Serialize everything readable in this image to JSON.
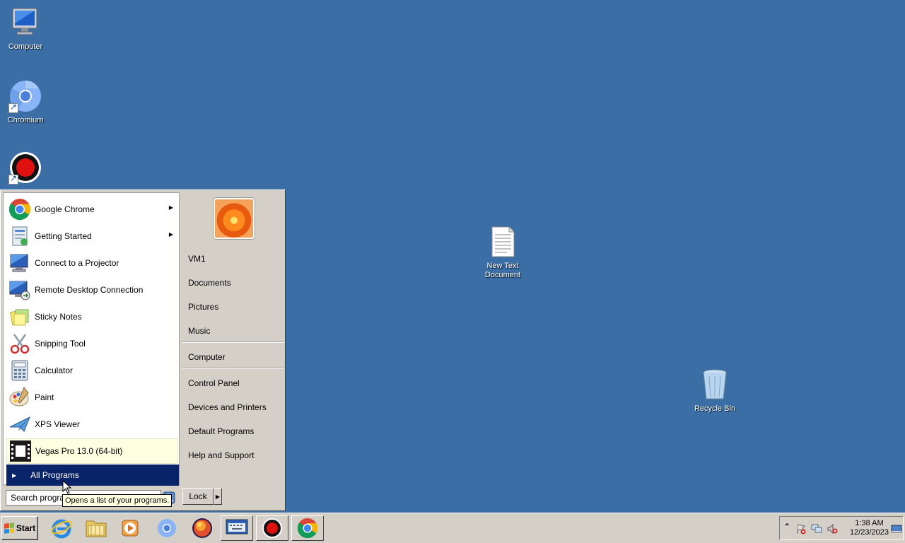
{
  "desktop": {
    "icons": [
      {
        "label": "Computer"
      },
      {
        "label": "Chromium"
      },
      {
        "label": "New Text Document"
      },
      {
        "label": "Recycle Bin"
      }
    ]
  },
  "start_menu": {
    "programs": [
      {
        "label": "Google Chrome",
        "has_submenu": true
      },
      {
        "label": "Getting Started",
        "has_submenu": true
      },
      {
        "label": "Connect to a Projector"
      },
      {
        "label": "Remote Desktop Connection"
      },
      {
        "label": "Sticky Notes"
      },
      {
        "label": "Snipping Tool"
      },
      {
        "label": "Calculator"
      },
      {
        "label": "Paint"
      },
      {
        "label": "XPS Viewer"
      },
      {
        "label": "Vegas Pro 13.0 (64-bit)"
      }
    ],
    "all_programs_label": "All Programs",
    "search_placeholder": "Search programs and files",
    "search_text": "Search program",
    "tooltip": "Opens a list of your programs.",
    "right_links": {
      "user": "VM1",
      "documents": "Documents",
      "pictures": "Pictures",
      "music": "Music",
      "computer": "Computer",
      "control_panel": "Control Panel",
      "devices": "Devices and Printers",
      "default_programs": "Default Programs",
      "help": "Help and Support"
    },
    "lock_label": "Lock"
  },
  "taskbar": {
    "start_label": "Start",
    "clock_time": "1:38 AM",
    "clock_date": "12/23/2023",
    "tray_expand": "⌃"
  },
  "colors": {
    "desktop": "#3a6ea5",
    "menu_bg": "#d4d0c8",
    "selection": "#0a246a",
    "highlight": "#ffffe1"
  }
}
